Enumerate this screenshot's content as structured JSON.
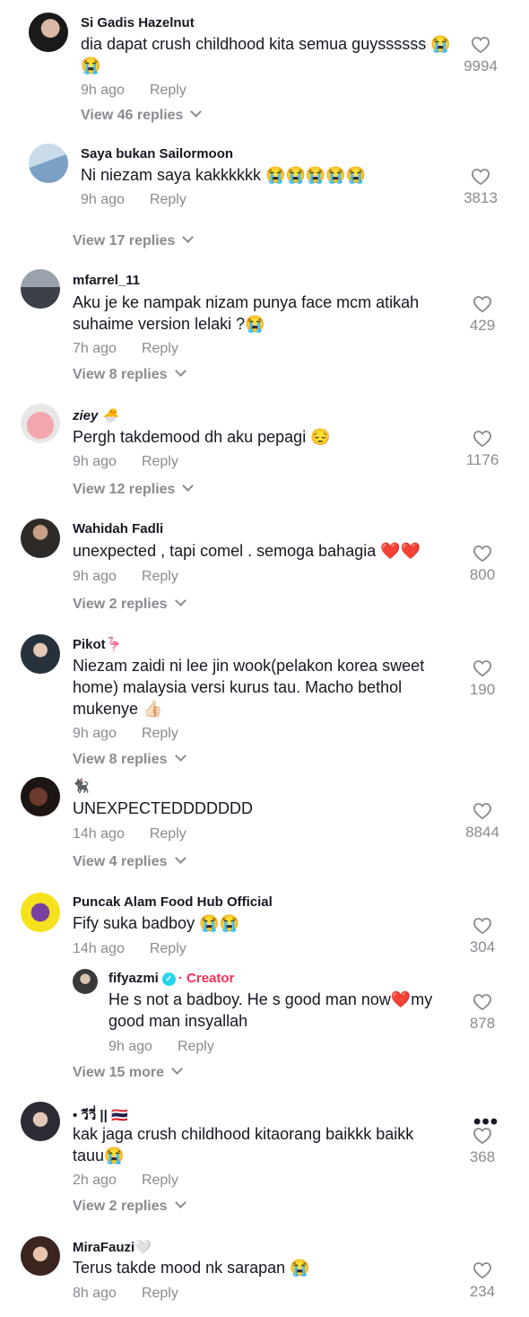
{
  "comments": [
    {
      "user": "Si Gadis Hazelnut",
      "text": "dia dapat crush childhood kita semua guyssssss 😭 😭",
      "time": "9h ago",
      "reply": "Reply",
      "likes": "9994",
      "view": "View 46 replies"
    },
    {
      "user": "Saya bukan Sailormoon",
      "text": "Ni niezam saya kakkkkkk 😭😭😭😭😭",
      "time": "9h ago",
      "reply": "Reply",
      "likes": "3813",
      "view": "View 17 replies"
    },
    {
      "user": "mfarrel_11",
      "text": "Aku je ke nampak nizam punya face mcm atikah suhaime version lelaki ?😭",
      "time": "7h ago",
      "reply": "Reply",
      "likes": "429",
      "view": "View 8 replies"
    },
    {
      "user": "ziey 🐣",
      "text": "Pergh takdemood dh aku pepagi 😔",
      "time": "9h ago",
      "reply": "Reply",
      "likes": "1176",
      "view": "View 12 replies"
    },
    {
      "user": "Wahidah Fadli",
      "text": "unexpected , tapi comel . semoga bahagia ❤️❤️",
      "time": "9h ago",
      "reply": "Reply",
      "likes": "800",
      "view": "View 2 replies"
    },
    {
      "user": "Pikot🦩",
      "text": "Niezam zaidi ni lee jin wook(pelakon korea sweet home) malaysia versi kurus tau. Macho bethol mukenye 👍🏻",
      "time": "9h ago",
      "reply": "Reply",
      "likes": "190",
      "view": "View 8 replies"
    },
    {
      "user": "🐈‍⬛",
      "text": "UNEXPECTEDDDDDDD",
      "time": "14h ago",
      "reply": "Reply",
      "likes": "8844",
      "view": "View 4 replies"
    },
    {
      "user": "Puncak Alam Food Hub Official",
      "text": "Fify suka badboy 😭😭",
      "time": "14h ago",
      "reply": "Reply",
      "likes": "304",
      "view": "View 15 more"
    },
    {
      "user": "• วีวี่ || 🇹🇭",
      "text": "kak jaga crush childhood kitaorang baikkk baikk tauu😭",
      "time": "2h ago",
      "reply": "Reply",
      "likes": "368",
      "view": "View 2 replies"
    },
    {
      "user": "MiraFauzi🤍",
      "text": "Terus takde mood nk sarapan 😭",
      "time": "8h ago",
      "reply": "Reply",
      "likes": "234"
    }
  ],
  "creator_reply": {
    "user": "fifyazmi",
    "badge": "· Creator",
    "text": "He s not a badboy. He s good man now❤️my good man insyallah",
    "time": "9h ago",
    "reply": "Reply",
    "likes": "878"
  },
  "more_icon": "more-dots-icon"
}
